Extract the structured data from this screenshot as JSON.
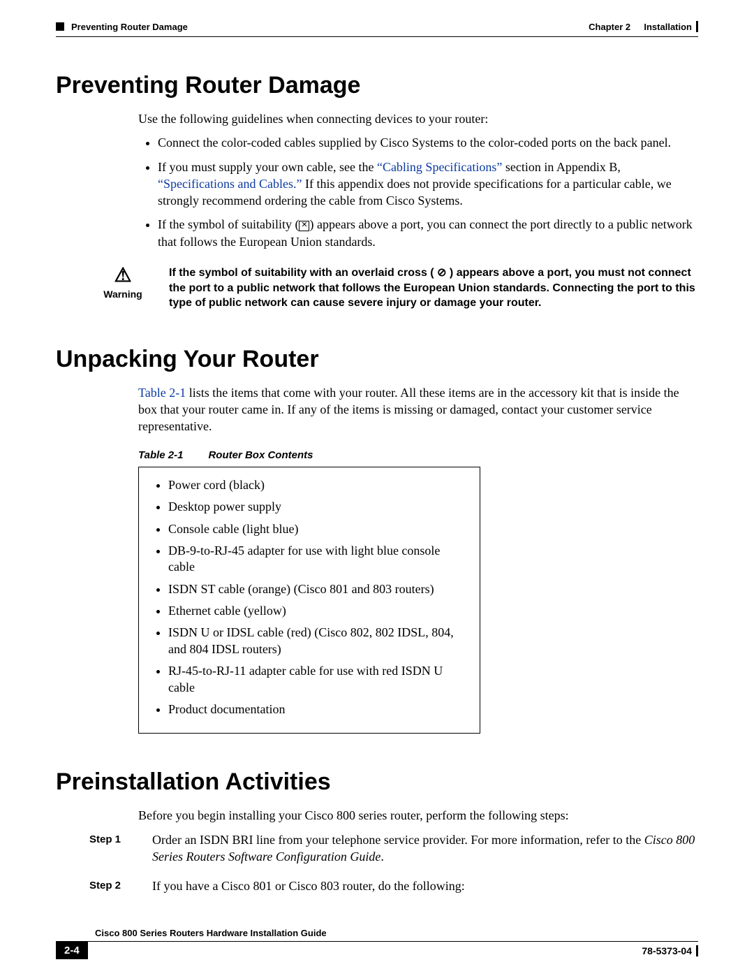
{
  "header": {
    "section_title": "Preventing Router Damage",
    "chapter_label": "Chapter 2",
    "chapter_name": "Installation"
  },
  "s1": {
    "heading": "Preventing Router Damage",
    "intro": "Use the following guidelines when connecting devices to your router:",
    "b1": "Connect the color-coded cables supplied by Cisco Systems to the color-coded ports on the back panel.",
    "b2a": "If you must supply your own cable, see the ",
    "b2link1": "Cabling Specifications",
    "b2b": " section in Appendix B, ",
    "b2link2": "Specifications and Cables.",
    "b2c": " If this appendix does not provide specifications for a particular cable, we strongly recommend ordering the cable from Cisco Systems.",
    "b3a": "If the symbol of suitability (",
    "b3b": ") appears above a port, you can connect the port directly to a public network that follows the European Union standards.",
    "warning_label": "Warning",
    "warning_text_a": "If the symbol of suitability with an overlaid cross ( ",
    "warning_text_b": " ) appears above a port, you must not connect the port to a public network that follows the European Union standards. Connecting the port to this type of public network can cause severe injury or damage your router."
  },
  "s2": {
    "heading": "Unpacking Your Router",
    "para_link": "Table 2-1",
    "para_rest": " lists the items that come with your router. All these items are in the accessory kit that is inside the box that your router came in. If any of the items is missing or damaged, contact your customer service representative.",
    "table_num": "Table 2-1",
    "table_title": "Router Box Contents",
    "items": [
      "Power cord (black)",
      "Desktop power supply",
      "Console cable (light blue)",
      "DB-9-to-RJ-45 adapter for use with light blue console cable",
      "ISDN ST cable (orange) (Cisco 801 and 803 routers)",
      "Ethernet cable (yellow)",
      "ISDN U or IDSL cable (red) (Cisco 802, 802 IDSL, 804, and 804 IDSL routers)",
      "RJ-45-to-RJ-11 adapter cable for use with red ISDN U cable",
      "Product documentation"
    ]
  },
  "s3": {
    "heading": "Preinstallation Activities",
    "intro": "Before you begin installing your Cisco 800 series router, perform the following steps:",
    "step1_label": "Step 1",
    "step1_a": "Order an ISDN BRI line from your telephone service provider. For more information, refer to the ",
    "step1_i": "Cisco 800 Series Routers Software Configuration Guide",
    "step1_b": ".",
    "step2_label": "Step 2",
    "step2": "If you have a Cisco 801 or Cisco 803 router, do the following:"
  },
  "footer": {
    "guide": "Cisco 800 Series Routers Hardware Installation Guide",
    "page": "2-4",
    "docnum": "78-5373-04"
  }
}
